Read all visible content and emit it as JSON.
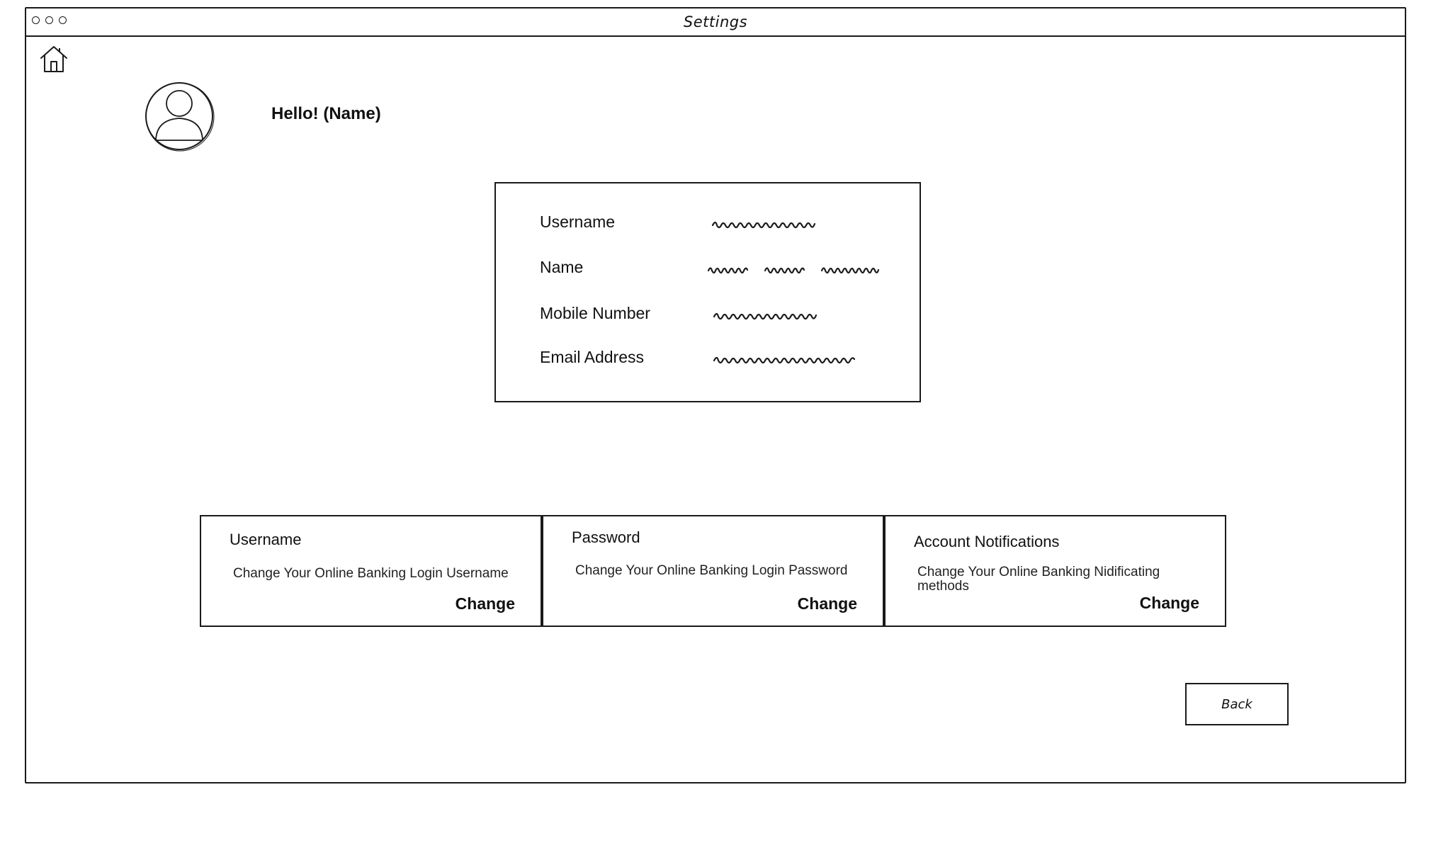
{
  "window": {
    "title": "Settings"
  },
  "header": {
    "greeting": "Hello! (Name)"
  },
  "icons": {
    "home": "home-icon",
    "avatar": "user-avatar-icon"
  },
  "profile": {
    "rows": [
      {
        "label": "Username"
      },
      {
        "label": "Name"
      },
      {
        "label": "Mobile Number"
      },
      {
        "label": "Email Address"
      }
    ]
  },
  "options": [
    {
      "title": "Username",
      "description": "Change Your Online Banking Login Username",
      "action": "Change"
    },
    {
      "title": "Password",
      "description": "Change Your Online Banking Login Password",
      "action": "Change"
    },
    {
      "title": "Account Notifications",
      "description": "Change Your Online Banking Nidificating methods",
      "action": "Change"
    }
  ],
  "footer": {
    "back_label": "Back"
  }
}
